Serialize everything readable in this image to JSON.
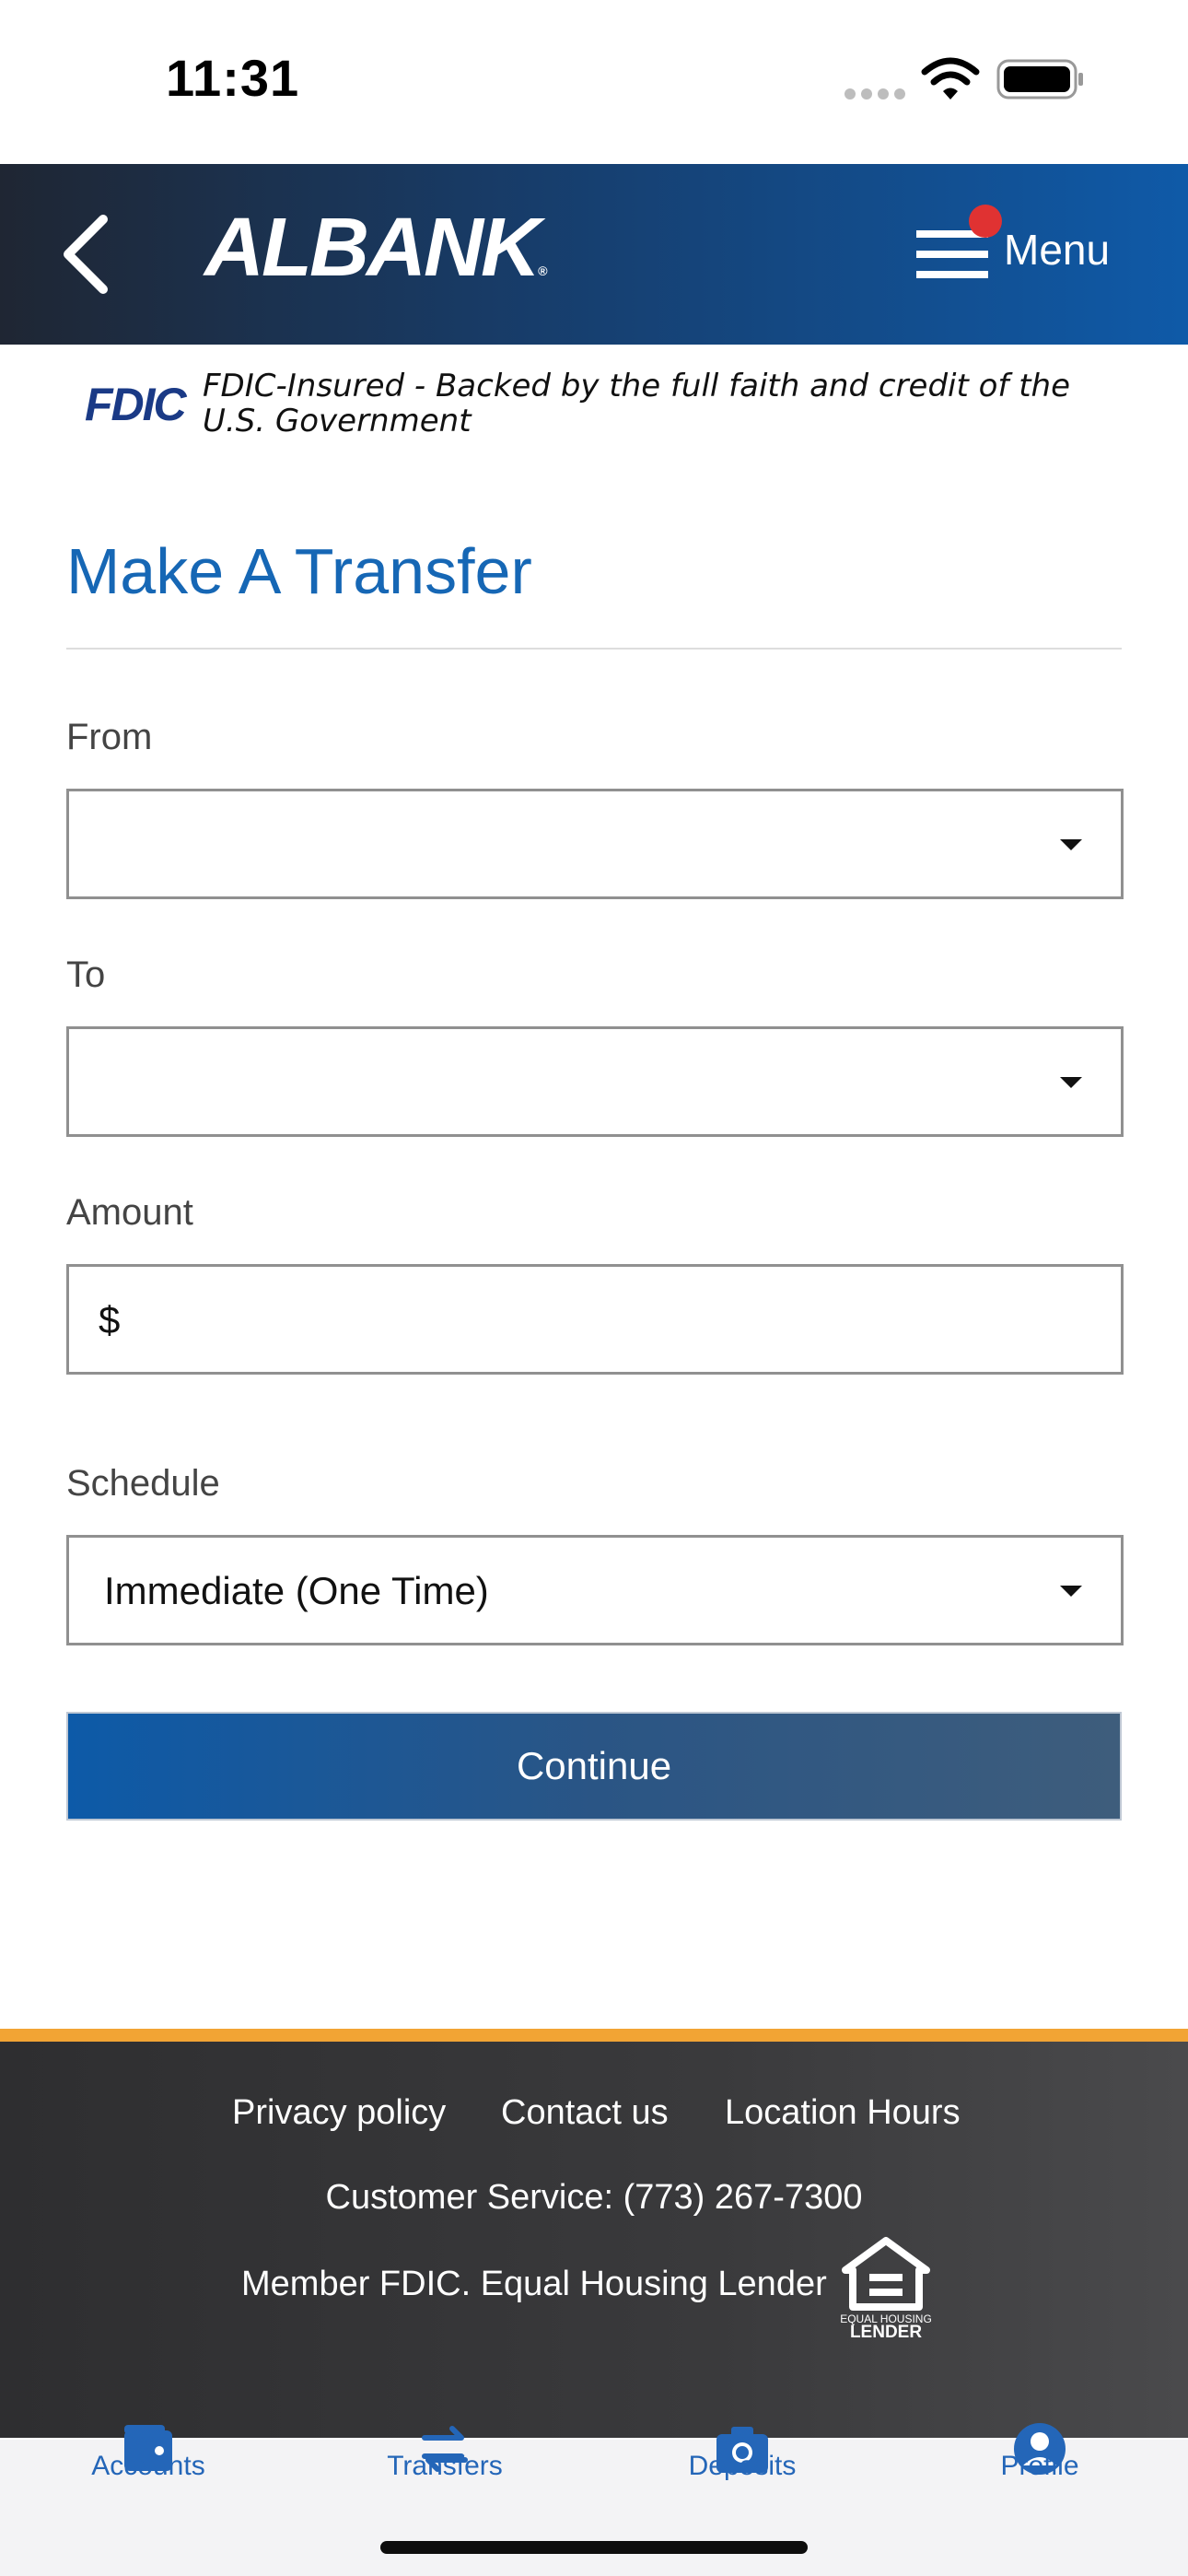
{
  "status_bar": {
    "time": "11:31"
  },
  "header": {
    "back_icon": "chevron-left-icon",
    "logo": "ALBANK",
    "logo_reg": "®",
    "menu_label": "Menu",
    "notification_color": "#e03232"
  },
  "fdic": {
    "logo": "FDIC",
    "text": "FDIC-Insured - Backed by the full faith and credit of the U.S. Government"
  },
  "page": {
    "title": "Make A Transfer",
    "from": {
      "label": "From",
      "value": ""
    },
    "to": {
      "label": "To",
      "value": ""
    },
    "amount": {
      "label": "Amount",
      "currency": "$",
      "value": ""
    },
    "schedule": {
      "label": "Schedule",
      "value": "Immediate (One Time)"
    },
    "continue_label": "Continue"
  },
  "footer": {
    "links": [
      "Privacy policy",
      "Contact us",
      "Location Hours"
    ],
    "phone": "Customer Service: (773) 267-7300",
    "member": "Member FDIC. Equal Housing Lender",
    "ehl_line1": "EQUAL HOUSING",
    "ehl_line2": "LENDER",
    "accent_color": "#f2a434"
  },
  "tabs": [
    {
      "label": "Accounts",
      "icon": "wallet-icon"
    },
    {
      "label": "Transfers",
      "icon": "transfer-arrows-icon"
    },
    {
      "label": "Deposits",
      "icon": "camera-icon"
    },
    {
      "label": "Profile",
      "icon": "user-icon"
    }
  ],
  "colors": {
    "primary": "#1667b5",
    "tab_label": "#2466b8"
  }
}
